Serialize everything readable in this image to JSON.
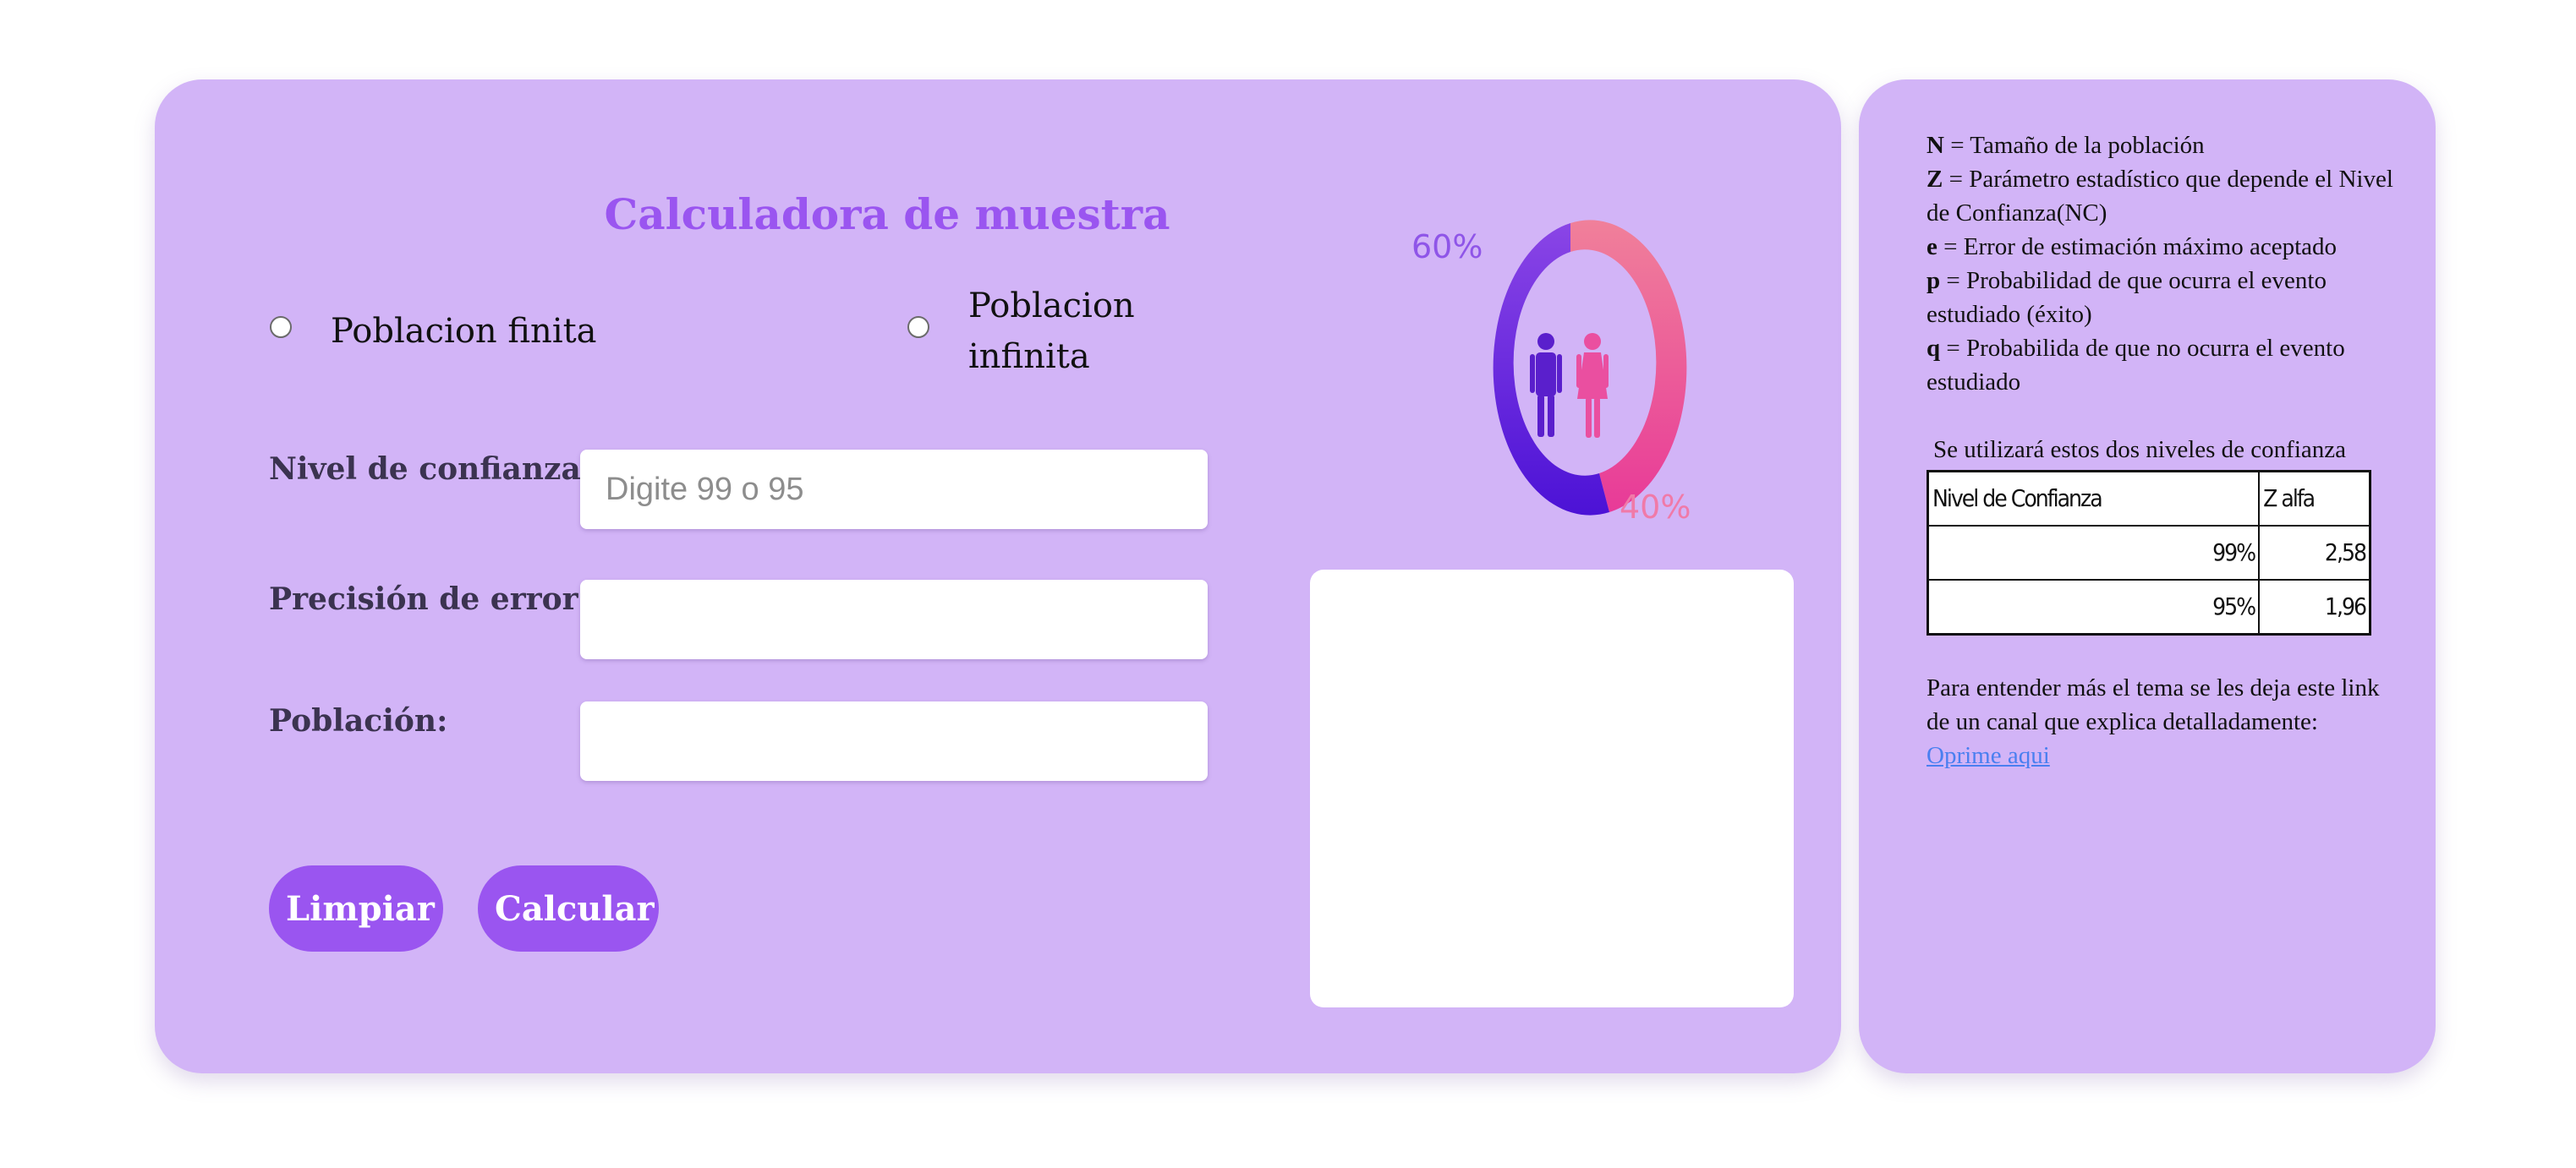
{
  "calculator": {
    "title": "Calculadora de muestra",
    "radio_finite_label": "Poblacion finita",
    "radio_infinite_line1": "Poblacion",
    "radio_infinite_line2": "infinita",
    "confidence_label": "Nivel de confianza :",
    "confidence_placeholder": "Digite 99 o 95",
    "confidence_value": "",
    "error_label": "Precisión de error:",
    "error_value": "",
    "population_label": "Población:",
    "population_value": "",
    "clear_button": "Limpiar",
    "calculate_button": "Calcular",
    "result_text": ""
  },
  "illustration": {
    "male_percent": "60%",
    "female_percent": "40%",
    "male_color": "#7d3fe0",
    "female_color": "#ee4f9a",
    "male_share": 0.6,
    "female_share": 0.4
  },
  "definitions": [
    {
      "symbol": "N",
      "text": " = Tamaño de la población"
    },
    {
      "symbol": "Z",
      "text": " = Parámetro estadístico que depende el Nivel de Confianza(NC)"
    },
    {
      "symbol": "e",
      "text": " = Error de estimación máximo aceptado"
    },
    {
      "symbol": "p",
      "text": " = Probabilidad de que ocurra el evento estudiado (éxito)"
    },
    {
      "symbol": "q",
      "text": " = Probabilida de que no ocurra el evento estudiado"
    }
  ],
  "confidence_levels": {
    "intro": "Se utilizará estos dos niveles de confianza",
    "headers": [
      "Nivel de Confianza",
      "Z alfa"
    ],
    "rows": [
      [
        "99%",
        "2,58"
      ],
      [
        "95%",
        "1,96"
      ]
    ]
  },
  "resource": {
    "text": "Para entender más el tema se les deja este link de un canal que explica detalladamente:",
    "link_label": "Oprime aqui"
  }
}
